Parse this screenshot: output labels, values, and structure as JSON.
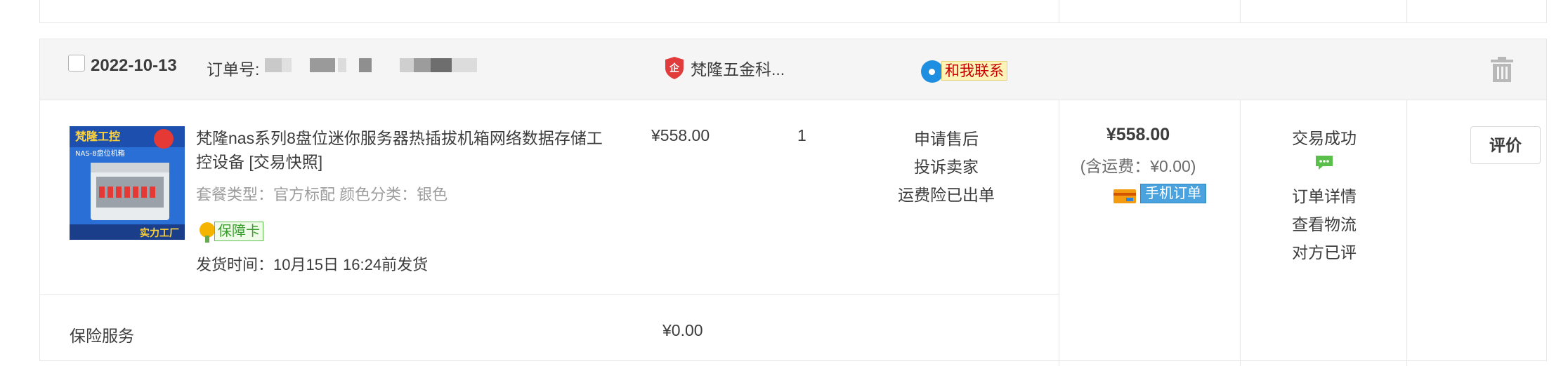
{
  "colors": {
    "border": "#e6e6e6",
    "header_bg": "#f5f5f5",
    "text": "#3c3c3c",
    "muted": "#9c9c9c",
    "contact_bg": "#fff4b8",
    "contact_text": "#c40000",
    "mobile_tag_bg": "#4aa3df",
    "chat_green": "#5bbf4b"
  },
  "order": {
    "date": "2022-10-13",
    "order_no_label": "订单号:",
    "shop_name": "梵隆五金科...",
    "contact_label": "和我联系",
    "icons": {
      "shop": "shop-badge-icon",
      "contact": "wangwang-icon",
      "delete": "trash-icon"
    }
  },
  "item": {
    "thumb_texts": [
      "梵隆工控",
      "NAS-8盘位机箱",
      "实力工厂"
    ],
    "title": "梵隆nas系列8盘位迷你服务器热插拔机箱网络数据存储工控设备 [交易快照]",
    "props": "套餐类型：官方标配   颜色分类：银色",
    "badge": "保障卡",
    "ship_time": "发货时间：10月15日 16:24前发货",
    "price": "¥558.00",
    "quantity": "1",
    "ops": [
      "申请售后",
      "投诉卖家",
      "运费险已出单"
    ]
  },
  "payment": {
    "total": "¥558.00",
    "freight": "(含运费：¥0.00)",
    "mobile_tag": "手机订单"
  },
  "status": {
    "text": "交易成功",
    "links": [
      "订单详情",
      "查看物流",
      "对方已评"
    ]
  },
  "actions": {
    "review": "评价"
  },
  "insurance": {
    "label": "保险服务",
    "price": "¥0.00"
  }
}
